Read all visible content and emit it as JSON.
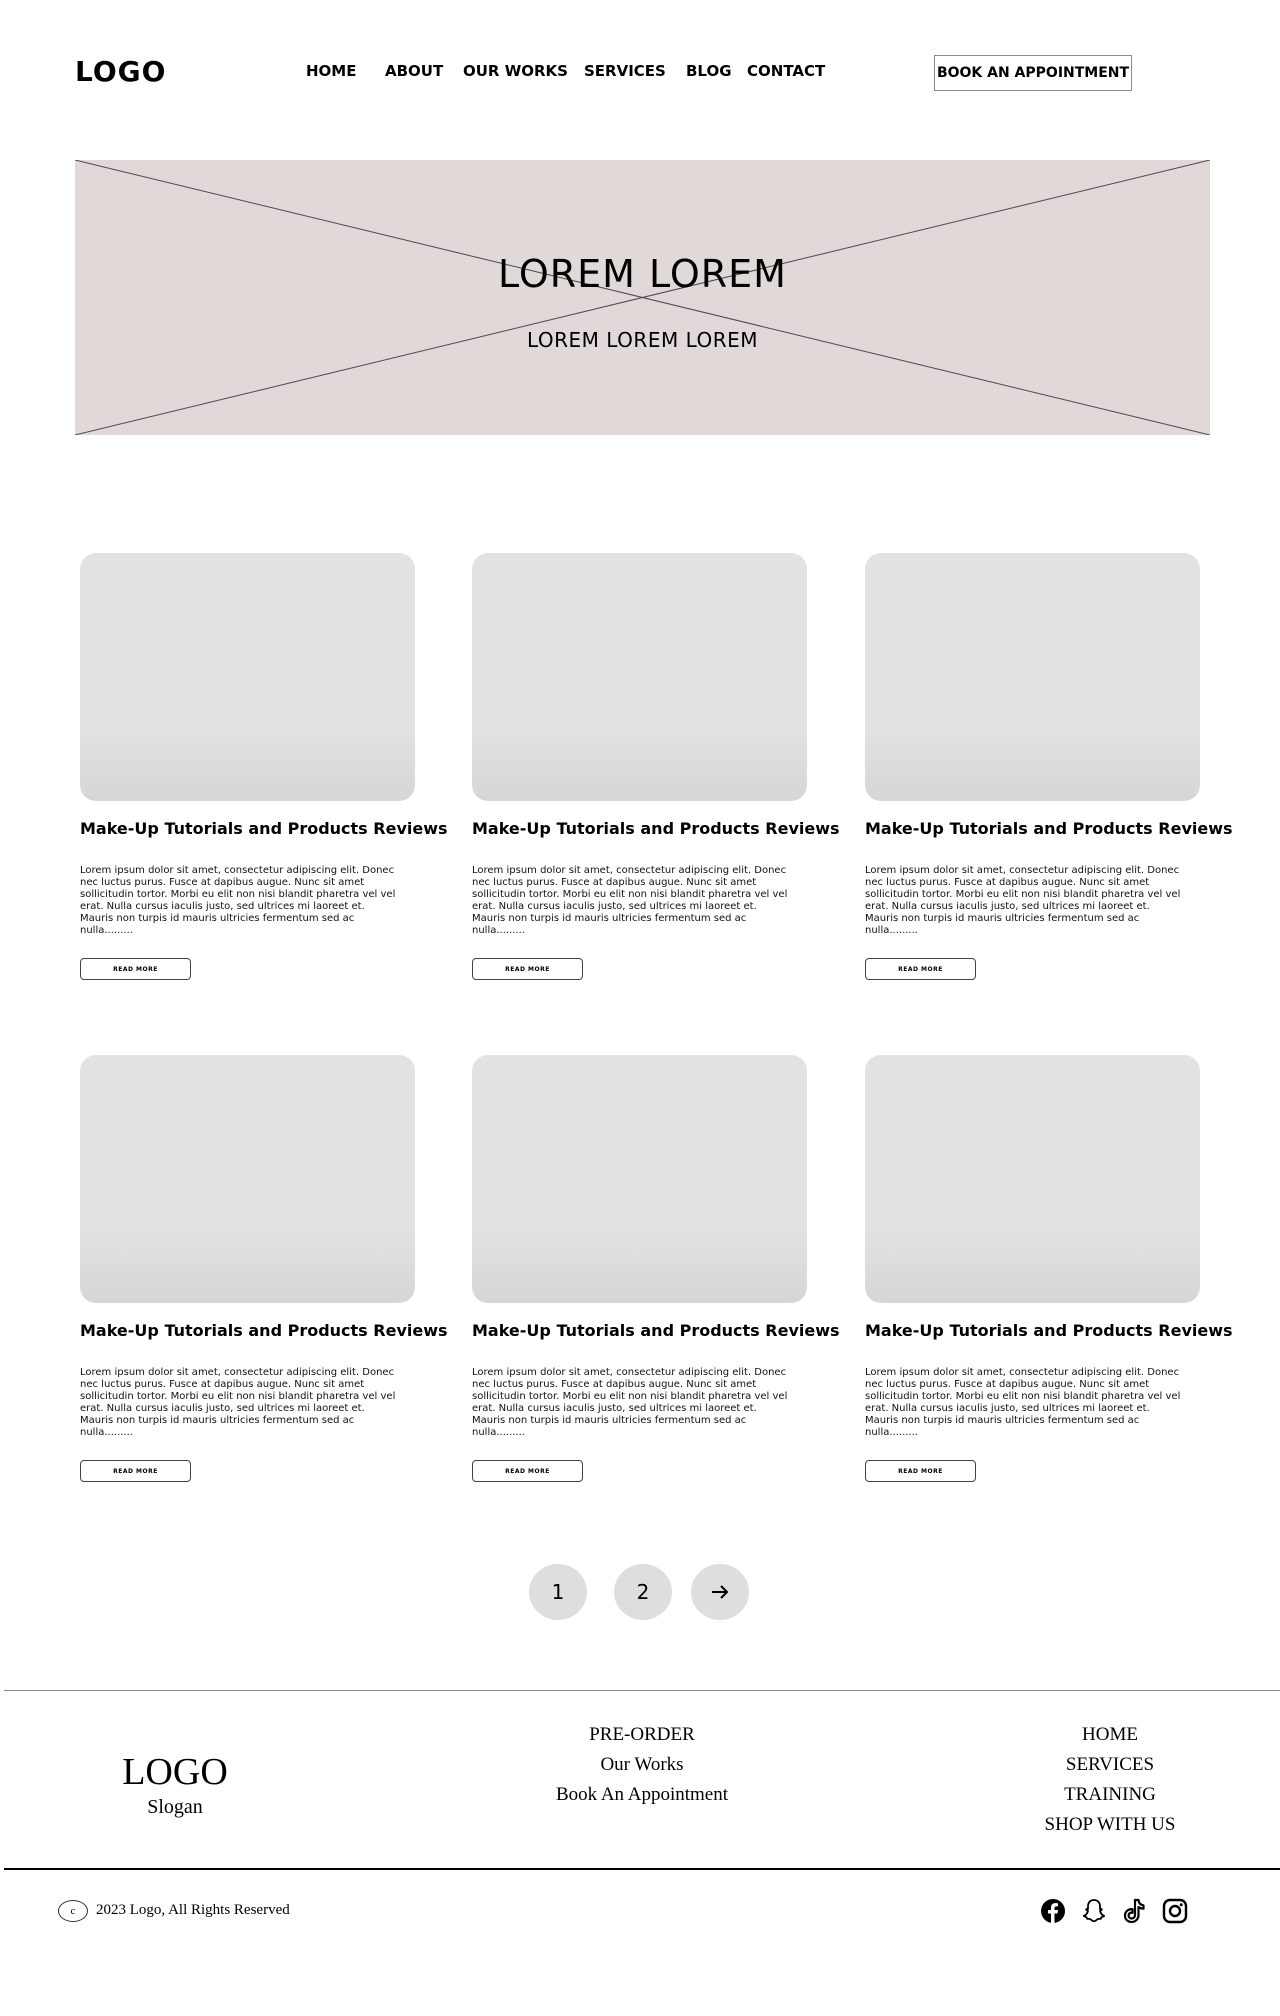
{
  "header": {
    "logo": "LOGO",
    "nav": [
      "HOME",
      "ABOUT",
      "OUR WORKS",
      "SERVICES",
      "BLOG",
      "CONTACT"
    ],
    "cta": "BOOK AN APPOINTMENT"
  },
  "hero": {
    "title": "LOREM LOREM",
    "subtitle": "LOREM LOREM LOREM"
  },
  "cards": [
    {
      "title": "Make-Up Tutorials and Products Reviews",
      "text": "Lorem ipsum dolor sit amet, consectetur adipiscing elit. Donec nec luctus purus. Fusce at dapibus augue. Nunc sit amet sollicitudin tortor. Morbi eu elit non nisi blandit pharetra vel vel erat. Nulla cursus iaculis justo, sed ultrices mi laoreet et. Mauris non turpis id mauris ultricies fermentum sed ac nulla.........",
      "button": "READ  MORE"
    },
    {
      "title": "Make-Up Tutorials and Products Reviews",
      "text": "Lorem ipsum dolor sit amet, consectetur adipiscing elit. Donec nec luctus purus. Fusce at dapibus augue. Nunc sit amet sollicitudin tortor. Morbi eu elit non nisi blandit pharetra vel vel erat. Nulla cursus iaculis justo, sed ultrices mi laoreet et. Mauris non turpis id mauris ultricies fermentum sed ac nulla.........",
      "button": "READ  MORE"
    },
    {
      "title": "Make-Up Tutorials and Products Reviews",
      "text": "Lorem ipsum dolor sit amet, consectetur adipiscing elit. Donec nec luctus purus. Fusce at dapibus augue. Nunc sit amet sollicitudin tortor. Morbi eu elit non nisi blandit pharetra vel vel erat. Nulla cursus iaculis justo, sed ultrices mi laoreet et. Mauris non turpis id mauris ultricies fermentum sed ac nulla.........",
      "button": "READ  MORE"
    },
    {
      "title": "Make-Up Tutorials and Products Reviews",
      "text": "Lorem ipsum dolor sit amet, consectetur adipiscing elit. Donec nec luctus purus. Fusce at dapibus augue. Nunc sit amet sollicitudin tortor. Morbi eu elit non nisi blandit pharetra vel vel erat. Nulla cursus iaculis justo, sed ultrices mi laoreet et. Mauris non turpis id mauris ultricies fermentum sed ac nulla.........",
      "button": "READ  MORE"
    },
    {
      "title": "Make-Up Tutorials and Products Reviews",
      "text": "Lorem ipsum dolor sit amet, consectetur adipiscing elit. Donec nec luctus purus. Fusce at dapibus augue. Nunc sit amet sollicitudin tortor. Morbi eu elit non nisi blandit pharetra vel vel erat. Nulla cursus iaculis justo, sed ultrices mi laoreet et. Mauris non turpis id mauris ultricies fermentum sed ac nulla.........",
      "button": "READ  MORE"
    },
    {
      "title": "Make-Up Tutorials and Products Reviews",
      "text": "Lorem ipsum dolor sit amet, consectetur adipiscing elit. Donec nec luctus purus. Fusce at dapibus augue. Nunc sit amet sollicitudin tortor. Morbi eu elit non nisi blandit pharetra vel vel erat. Nulla cursus iaculis justo, sed ultrices mi laoreet et. Mauris non turpis id mauris ultricies fermentum sed ac nulla.........",
      "button": "READ  MORE"
    }
  ],
  "pagination": {
    "pages": [
      "1",
      "2"
    ],
    "next_icon": "arrow-right-icon"
  },
  "footer": {
    "logo": "LOGO",
    "slogan": "Slogan",
    "middle_links": [
      "PRE-ORDER",
      "Our Works",
      "Book An Appointment"
    ],
    "right_links": [
      "HOME",
      "SERVICES",
      "TRAINING",
      "SHOP WITH US"
    ],
    "copyright_symbol": "c",
    "copyright": "2023 Logo, All Rights Reserved",
    "social_icons": [
      "facebook-icon",
      "snapchat-icon",
      "tiktok-icon",
      "instagram-icon"
    ]
  },
  "colors": {
    "hero_bg": "#e1d8d8",
    "card_placeholder": "#e2e2e2",
    "pagination_bg": "#dedede"
  }
}
